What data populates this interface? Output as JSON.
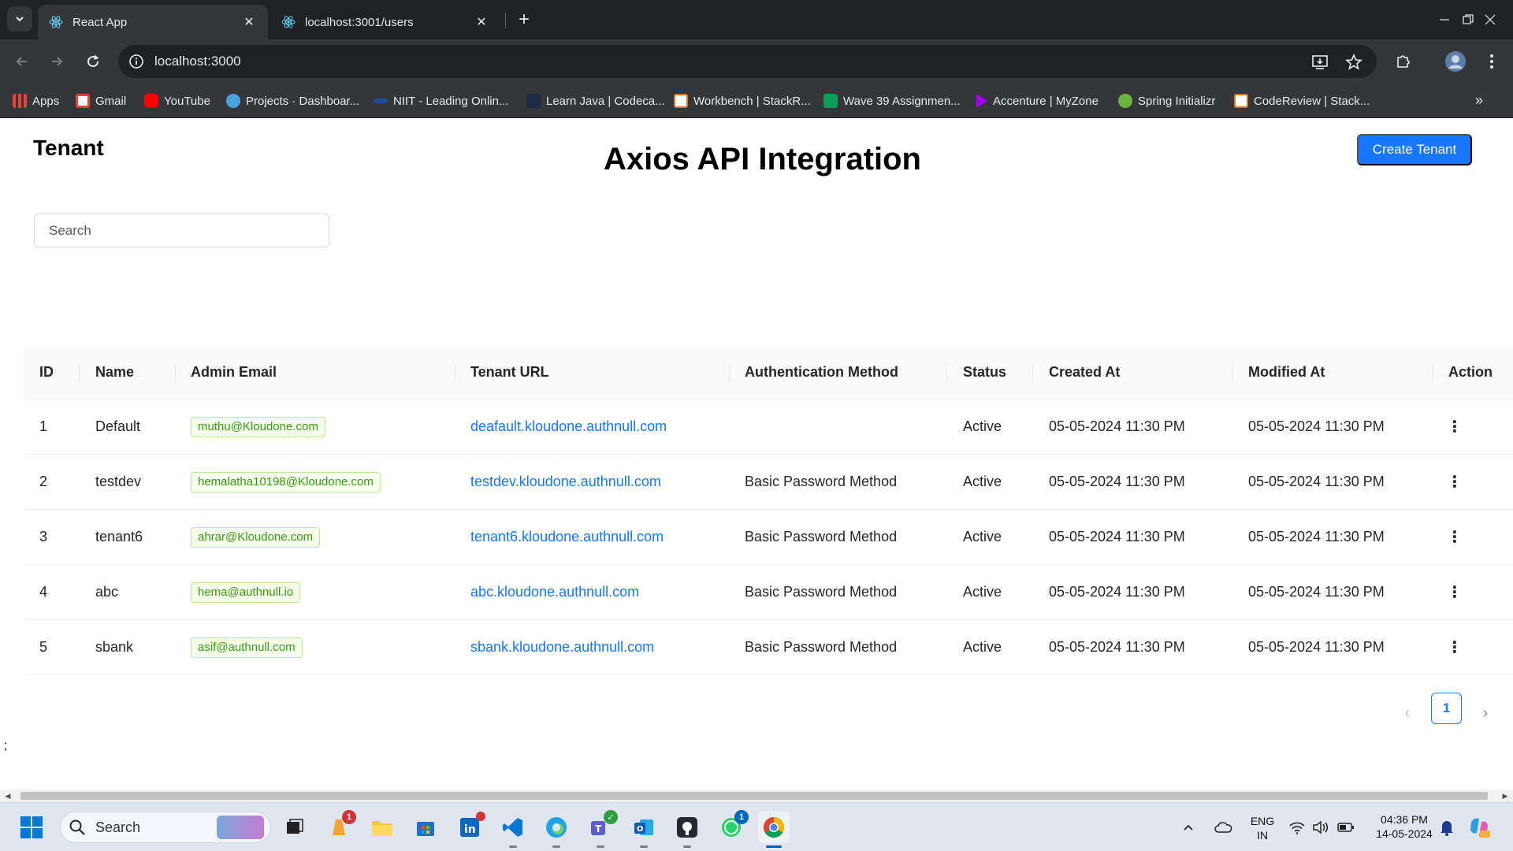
{
  "browser": {
    "tabs": [
      {
        "title": "React App",
        "active": true
      },
      {
        "title": "localhost:3001/users",
        "active": false
      }
    ],
    "url": "localhost:3000",
    "bookmarks": [
      {
        "label": "Apps",
        "color": "#4285f4"
      },
      {
        "label": "Gmail",
        "color": "#ea4335"
      },
      {
        "label": "YouTube",
        "color": "#ff0000"
      },
      {
        "label": "Projects · Dashboar...",
        "color": "#4aa3df"
      },
      {
        "label": "NIIT - Leading Onlin...",
        "color": "#1a4fa0"
      },
      {
        "label": "Learn Java | Codeca...",
        "color": "#1f2a44"
      },
      {
        "label": "Workbench | StackR...",
        "color": "#e8eaed"
      },
      {
        "label": "Wave 39 Assignmen...",
        "color": "#0f9d58"
      },
      {
        "label": "Accenture | MyZone",
        "color": "#a100ff"
      },
      {
        "label": "Spring Initializr",
        "color": "#6db33f"
      },
      {
        "label": "CodeReview | Stack...",
        "color": "#e8eaed"
      }
    ]
  },
  "page": {
    "heading": "Tenant",
    "title": "Axios API Integration",
    "create_button": "Create Tenant",
    "search_placeholder": "Search",
    "stray_text": ";"
  },
  "table": {
    "columns": [
      "ID",
      "Name",
      "Admin Email",
      "Tenant URL",
      "Authentication Method",
      "Status",
      "Created At",
      "Modified At",
      "Action"
    ],
    "rows": [
      {
        "id": "1",
        "name": "Default",
        "email": "muthu@Kloudone.com",
        "url": "deafault.kloudone.authnull.com",
        "auth": "",
        "status": "Active",
        "created": "05-05-2024 11:30 PM",
        "modified": "05-05-2024 11:30 PM"
      },
      {
        "id": "2",
        "name": "testdev",
        "email": "hemalatha10198@Kloudone.com",
        "url": "testdev.kloudone.authnull.com",
        "auth": "Basic Password Method",
        "status": "Active",
        "created": "05-05-2024 11:30 PM",
        "modified": "05-05-2024 11:30 PM"
      },
      {
        "id": "3",
        "name": "tenant6",
        "email": "ahrar@Kloudone.com",
        "url": "tenant6.kloudone.authnull.com",
        "auth": "Basic Password Method",
        "status": "Active",
        "created": "05-05-2024 11:30 PM",
        "modified": "05-05-2024 11:30 PM"
      },
      {
        "id": "4",
        "name": "abc",
        "email": "hema@authnull.io",
        "url": "abc.kloudone.authnull.com",
        "auth": "Basic Password Method",
        "status": "Active",
        "created": "05-05-2024 11:30 PM",
        "modified": "05-05-2024 11:30 PM"
      },
      {
        "id": "5",
        "name": "sbank",
        "email": "asif@authnull.com",
        "url": "sbank.kloudone.authnull.com",
        "auth": "Basic Password Method",
        "status": "Active",
        "created": "05-05-2024 11:30 PM",
        "modified": "05-05-2024 11:30 PM"
      }
    ],
    "current_page": "1"
  },
  "taskbar": {
    "search_label": "Search",
    "apps": [
      {
        "name": "widgets-app",
        "badge": ""
      },
      {
        "name": "task-view",
        "badge": ""
      },
      {
        "name": "scratch-app",
        "badge": "1"
      },
      {
        "name": "file-explorer",
        "badge": ""
      },
      {
        "name": "microsoft-store",
        "badge": ""
      },
      {
        "name": "linkedin",
        "badge": "•"
      },
      {
        "name": "vs-code",
        "badge": ""
      },
      {
        "name": "edge",
        "badge": ""
      },
      {
        "name": "teams",
        "badge": "✓"
      },
      {
        "name": "outlook",
        "badge": ""
      },
      {
        "name": "github-desktop",
        "badge": ""
      },
      {
        "name": "whatsapp",
        "badge": "1"
      },
      {
        "name": "chrome",
        "badge": ""
      }
    ],
    "language": "ENG",
    "region": "IN",
    "time": "04:36 PM",
    "date": "14-05-2024"
  }
}
